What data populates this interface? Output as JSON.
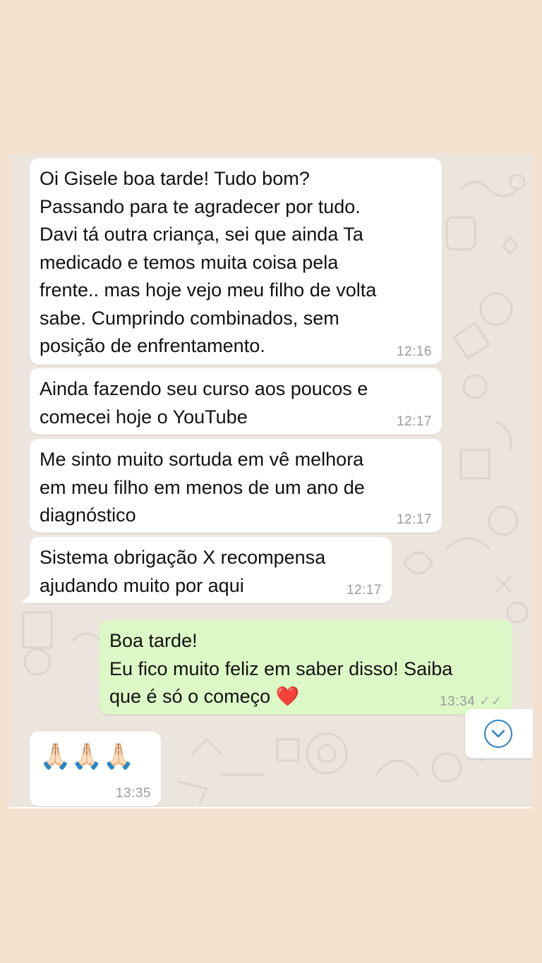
{
  "messages": [
    {
      "direction": "incoming",
      "lines": [
        "Oi Gisele boa tarde! Tudo bom?",
        "Passando para te agradecer por tudo.",
        "Davi tá outra criança, sei que ainda Ta",
        "medicado e temos muita coisa pela",
        "frente.. mas hoje vejo meu filho de volta",
        "sabe. Cumprindo combinados, sem",
        "posição de enfrentamento."
      ],
      "time": "12:16"
    },
    {
      "direction": "incoming",
      "lines": [
        "Ainda fazendo seu curso aos poucos e",
        "comecei hoje o YouTube"
      ],
      "time": "12:17"
    },
    {
      "direction": "incoming",
      "lines": [
        "Me sinto muito sortuda em vê melhora",
        "em meu filho em menos de um ano de",
        "diagnóstico"
      ],
      "time": "12:17"
    },
    {
      "direction": "incoming",
      "lines": [
        "Sistema obrigação X recompensa",
        "ajudando muito por aqui"
      ],
      "time": "12:17"
    },
    {
      "direction": "outgoing",
      "lines": [
        "Boa tarde!",
        "Eu fico muito feliz em saber disso! Saiba",
        "que é só o começo"
      ],
      "emoji": "❤️",
      "time": "13:34",
      "status": "read"
    },
    {
      "direction": "incoming",
      "emoji_text": "🙏🏻🙏🏻🙏🏻",
      "time": "13:35"
    }
  ],
  "icons": {
    "scroll_down": "chevron-down-circle-icon",
    "read_receipt": "double-check-icon"
  },
  "colors": {
    "page_background": "#f3e0cf",
    "chat_background": "#ece5dd",
    "incoming_bubble": "#ffffff",
    "outgoing_bubble": "#dcf8c6",
    "accent": "#2a7fc4"
  }
}
